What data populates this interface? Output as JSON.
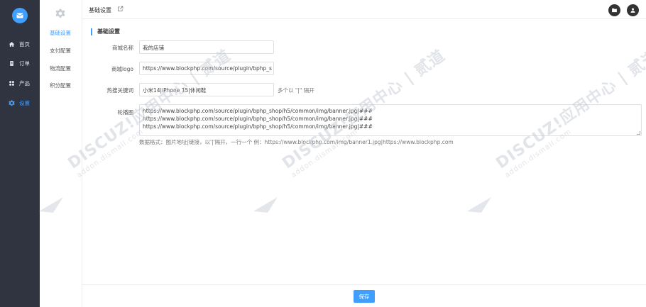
{
  "sidebar": {
    "items": [
      {
        "label": "首页",
        "icon": "home-icon"
      },
      {
        "label": "订单",
        "icon": "clipboard-icon"
      },
      {
        "label": "产品",
        "icon": "grid-icon"
      },
      {
        "label": "设置",
        "icon": "gear-icon"
      }
    ]
  },
  "submenu": {
    "items": [
      {
        "label": "基础设置"
      },
      {
        "label": "支付配置"
      },
      {
        "label": "物流配置"
      },
      {
        "label": "积分配置"
      }
    ]
  },
  "header": {
    "breadcrumb": "基础设置"
  },
  "form": {
    "section_title": "基础设置",
    "shop_name": {
      "label": "商城名称",
      "value": "我的店铺"
    },
    "shop_logo": {
      "label": "商城logo",
      "value": "https://www.blockphp.com/source/plugin/bphp_s"
    },
    "hot_keywords": {
      "label": "热搜关键词",
      "value": "小米14|iPhone 15|休闲鞋",
      "hint": "多个以 \"|\" 隔开"
    },
    "banner": {
      "label": "轮播图",
      "lines": [
        "https://www.blockphp.com/source/plugin/bphp_shop/h5/common/img/banner.jpg|###",
        "https://www.blockphp.com/source/plugin/bphp_shop/h5/common/img/banner.jpg|###",
        "https://www.blockphp.com/source/plugin/bphp_shop/h5/common/img/banner.jpg|###"
      ],
      "hint": "数据格式：图片地址|链接，以'|'隔开，一行一个    例：https://www.blockphp.com/img/banner1.jpg|https://www.blockphp.com"
    }
  },
  "footer": {
    "save_label": "保存"
  },
  "watermark": {
    "brand": "DISCUZ!应用中心 | 贰道",
    "domain": "addon.dismall.com"
  },
  "colors": {
    "sidebar_bg": "#2f3440",
    "accent": "#409eff"
  }
}
